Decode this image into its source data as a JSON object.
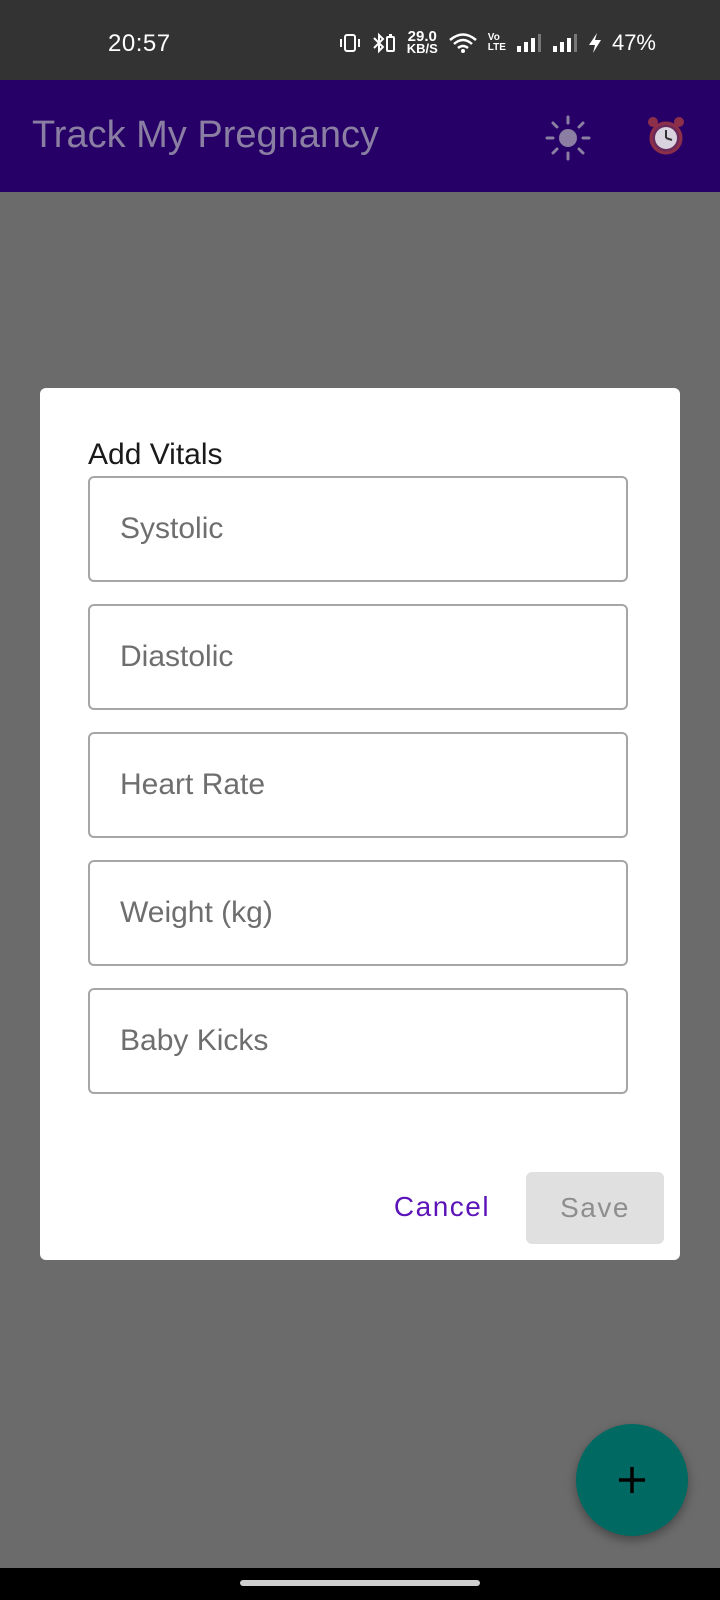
{
  "status_bar": {
    "time": "20:57",
    "net_speed_value": "29.0",
    "net_speed_unit": "KB/S",
    "volte_top": "Vo",
    "volte_bottom": "LTE",
    "battery": "47%",
    "icons": [
      "vibrate-icon",
      "bluetooth-battery-icon",
      "wifi-icon",
      "volte-icon",
      "signal-icon",
      "signal-icon",
      "charging-bolt-icon"
    ]
  },
  "app_bar": {
    "title": "Track My Pregnancy",
    "background": "#260066",
    "icons": [
      "sun-icon",
      "alarm-clock-icon"
    ]
  },
  "dialog": {
    "title": "Add Vitals",
    "fields": [
      {
        "placeholder": "Systolic",
        "value": ""
      },
      {
        "placeholder": "Diastolic",
        "value": ""
      },
      {
        "placeholder": "Heart Rate",
        "value": ""
      },
      {
        "placeholder": "Weight (kg)",
        "value": ""
      },
      {
        "placeholder": "Baby Kicks",
        "value": ""
      }
    ],
    "cancel_label": "Cancel",
    "save_label": "Save",
    "accent_color": "#5c14b8"
  },
  "fab": {
    "icon": "plus-icon",
    "color": "#006a62"
  }
}
